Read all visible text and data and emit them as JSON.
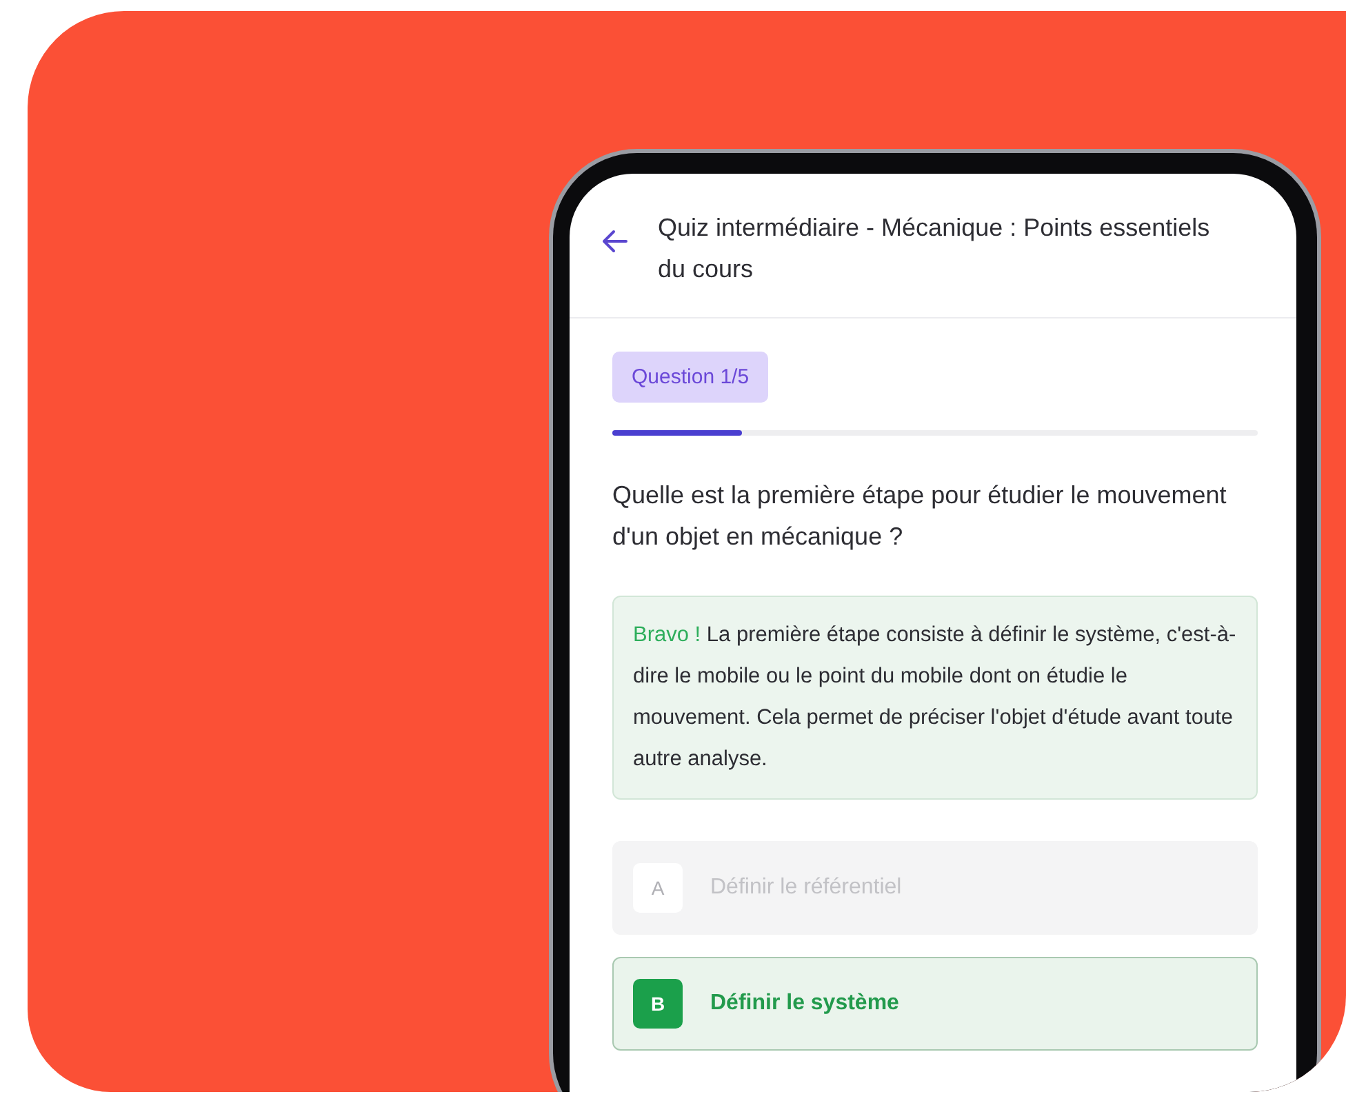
{
  "header": {
    "title": "Quiz intermédiaire - Mécanique : Points essentiels du cours"
  },
  "progress": {
    "badge": "Question 1/5",
    "level": 0.2
  },
  "question": "Quelle est la première étape pour étudier le mouvement d'un objet en mécanique ?",
  "feedback": {
    "lead": "Bravo !",
    "text": "La première étape consiste à définir le système, c'est-à-dire le mobile ou le point du mobile dont on étudie le mouvement. Cela permet de préciser l'objet d'étude avant toute autre analyse."
  },
  "options": [
    {
      "letter": "A",
      "text": "Définir le référentiel",
      "selected": false
    },
    {
      "letter": "B",
      "text": "Définir le système",
      "selected": true
    }
  ]
}
